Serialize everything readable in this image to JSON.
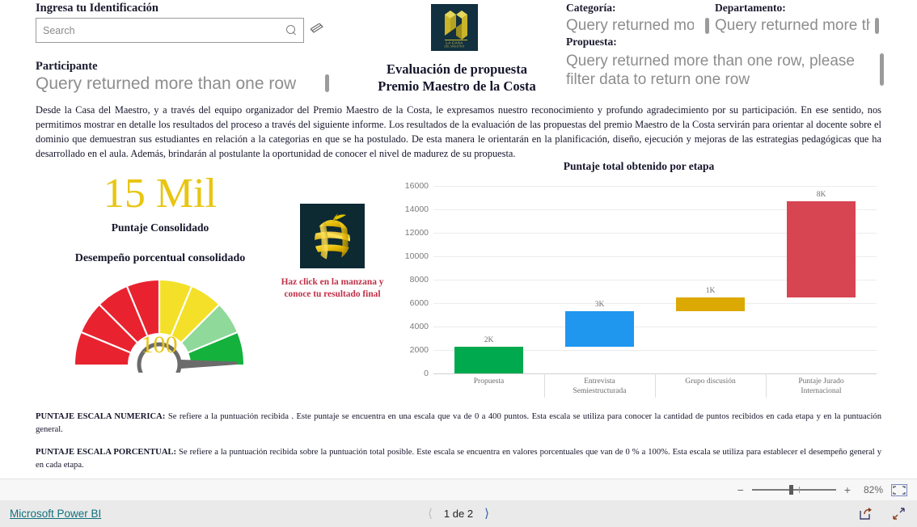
{
  "slicer": {
    "title": "Ingresa tu Identificación",
    "placeholder": "Search",
    "value": "",
    "search_icon": "search-icon",
    "clear_icon": "eraser-icon"
  },
  "participante": {
    "label": "Participante",
    "value": "Query returned more than one row"
  },
  "header": {
    "logo_text_line1": "LA CASA",
    "logo_text_line2": "DEL MAESTRO",
    "title_line1": "Evaluación de propuesta",
    "title_line2": "Premio Maestro de la Costa"
  },
  "fields": [
    {
      "label": "Categoría:",
      "value": "Query returned more than one row, please filter data to return one row"
    },
    {
      "label": "Departamento:",
      "value": "Query returned more than one row, please filter data to return one row"
    },
    {
      "label": "Propuesta:",
      "value": "Query returned more than one row, please filter data to return one row"
    }
  ],
  "intro_paragraph": "Desde la Casa del Maestro, y a través del equipo organizador del Premio Maestro de la Costa, le expresamos nuestro reconocimiento y profundo agradecimiento por su participación. En ese sentido, nos permitimos mostrar en detalle los resultados del proceso a través del siguiente informe.  Los resultados de la evaluación de las propuestas del premio Maestro de la Costa servirán para orientar al docente sobre el dominio que demuestran sus estudiantes en relación a la categorias en que se ha postulado. De esta manera le orientarán en la planificación, diseño, ejecución y mejoras de las estrategias pedagógicas que ha desarrollado en el aula. Además, brindarán al postulante la oportunidad de conocer el nivel de madurez de su propuesta.",
  "kpi": {
    "value": "15 Mil",
    "caption": "Puntaje Consolidado",
    "color": "#E8C511"
  },
  "gauge": {
    "title": "Desempeño porcentual consolidado",
    "value": "100",
    "value_color": "#E8C511",
    "segments": [
      {
        "color": "#E8232F"
      },
      {
        "color": "#E8232F"
      },
      {
        "color": "#E8232F"
      },
      {
        "color": "#E8232F"
      },
      {
        "color": "#F4E028"
      },
      {
        "color": "#F4E028"
      },
      {
        "color": "#8FD99A"
      },
      {
        "color": "#14B23C"
      }
    ],
    "needle_color": "#6b6b6b"
  },
  "apple": {
    "icon": "golden-apple-icon",
    "caption": "Haz click en la manzana y conoce tu resultado final",
    "caption_color": "#C03048",
    "background": "#0d2a33"
  },
  "chart_data": {
    "type": "bar",
    "title": "Puntaje total obtenido por etapa",
    "xlabel": "",
    "ylabel": "",
    "ylim": [
      0,
      16000
    ],
    "yticks": [
      0,
      2000,
      4000,
      6000,
      8000,
      10000,
      12000,
      14000,
      16000
    ],
    "ytick_labels": [
      "0",
      "2000",
      "4000",
      "6000",
      "8000",
      "10000",
      "12000",
      "14000",
      "16000"
    ],
    "grid": true,
    "legend": "none",
    "waterfall": true,
    "categories": [
      "Propuesta",
      "Entrevista\nSemiestructurada",
      "Grupo discusión",
      "Puntaje Jurado\nInternacional"
    ],
    "values": [
      2250,
      3050,
      1150,
      8250
    ],
    "bases": [
      0,
      2250,
      5300,
      6450
    ],
    "data_labels": [
      "2K",
      "3K",
      "1K",
      "8K"
    ],
    "colors": [
      "#01A94E",
      "#1F97EF",
      "#DBA901",
      "#D74452"
    ]
  },
  "footnotes": [
    {
      "title": "PUNTAJE ESCALA NUMERICA:",
      "text": " Se refiere a la puntuación recibida . Este puntaje se encuentra en una escala que va de 0 a 400 puntos. Esta escala se utiliza para conocer la cantidad de puntos recibidos en cada etapa y en la puntuación general."
    },
    {
      "title": "PUNTAJE ESCALA PORCENTUAL:",
      "text": " Se refiere a la puntuación recibida sobre la puntuación total posible. Este escala se encuentra en valores porcentuales que van de 0 % a 100%. Esta escala se utiliza para establecer el desempeño general y en cada etapa."
    }
  ],
  "zoombar": {
    "minus": "−",
    "plus": "+",
    "zoom_level": "82%",
    "fit_icon": "fit-to-page-icon"
  },
  "statusbar": {
    "brand": "Microsoft Power BI",
    "prev_icon": "chevron-left-icon",
    "page_text": "1 de 2",
    "next_icon": "chevron-right-icon",
    "share_icon": "share-export-icon",
    "fullscreen_icon": "fullscreen-icon"
  }
}
